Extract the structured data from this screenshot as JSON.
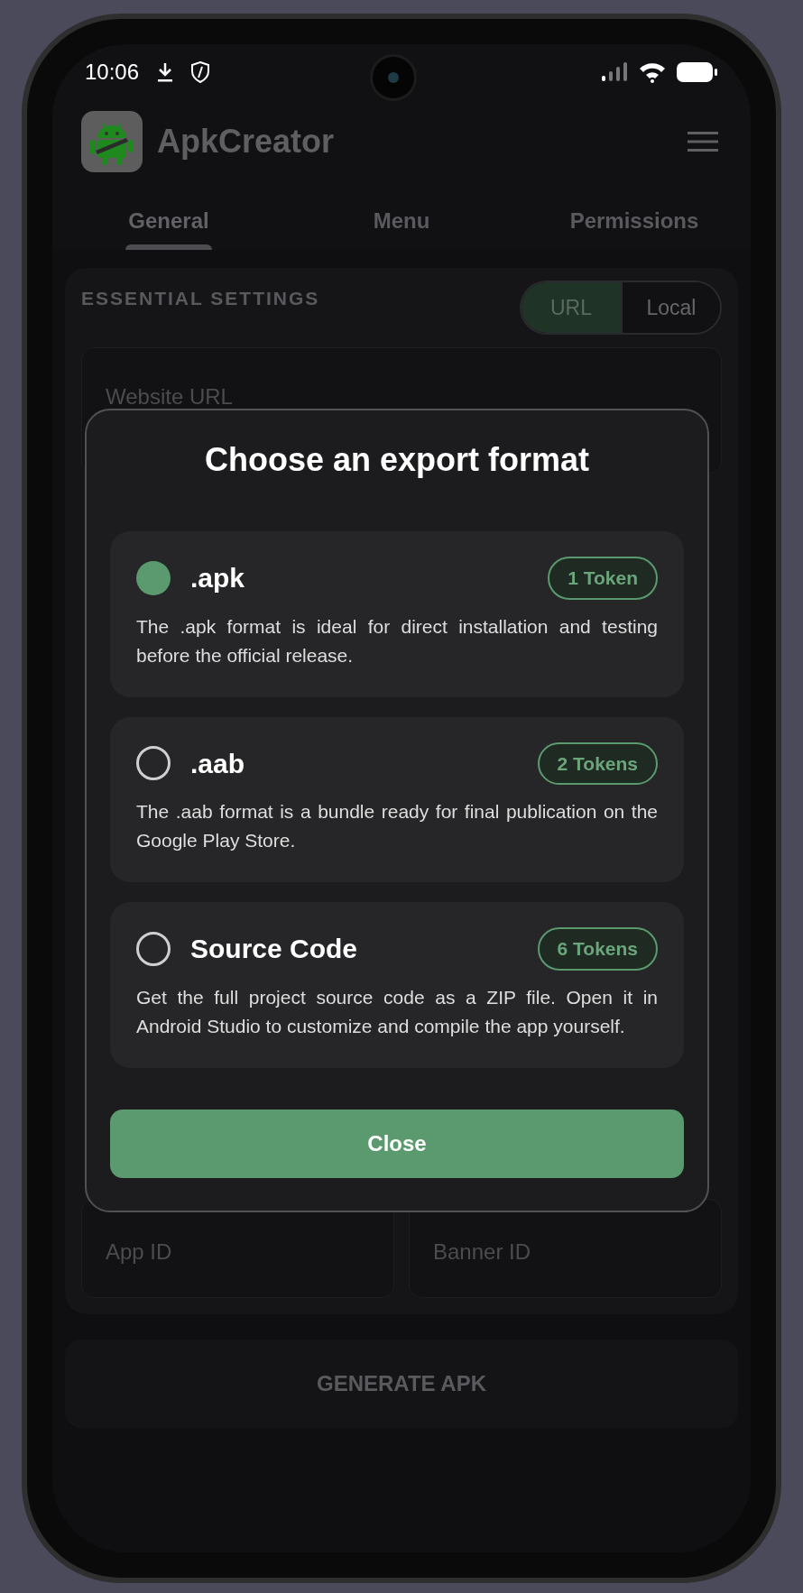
{
  "status_bar": {
    "time": "10:06"
  },
  "app_bar": {
    "title": "ApkCreator"
  },
  "tabs": [
    {
      "label": "General",
      "selected": true
    },
    {
      "label": "Menu",
      "selected": false
    },
    {
      "label": "Permissions",
      "selected": false
    }
  ],
  "settings": {
    "heading": "ESSENTIAL SETTINGS",
    "source_toggle": [
      {
        "label": "URL",
        "selected": true
      },
      {
        "label": "Local",
        "selected": false
      }
    ],
    "website_url": {
      "placeholder": "Website URL"
    },
    "app_id": {
      "placeholder": "App ID"
    },
    "banner_id": {
      "placeholder": "Banner ID"
    }
  },
  "generate_button": "GENERATE APK",
  "dialog": {
    "title": "Choose an export format",
    "options": [
      {
        "name": ".apk",
        "badge": "1 Token",
        "selected": true,
        "description": "The .apk format is ideal for direct installation and testing before the official release."
      },
      {
        "name": ".aab",
        "badge": "2 Tokens",
        "selected": false,
        "description": "The .aab format is a bundle ready for final publication on the Google Play Store."
      },
      {
        "name": "Source Code",
        "badge": "6 Tokens",
        "selected": false,
        "description": "Get the full project source code as a ZIP file. Open it in Android Studio to customize and compile the app yourself."
      }
    ],
    "close_button": "Close"
  }
}
